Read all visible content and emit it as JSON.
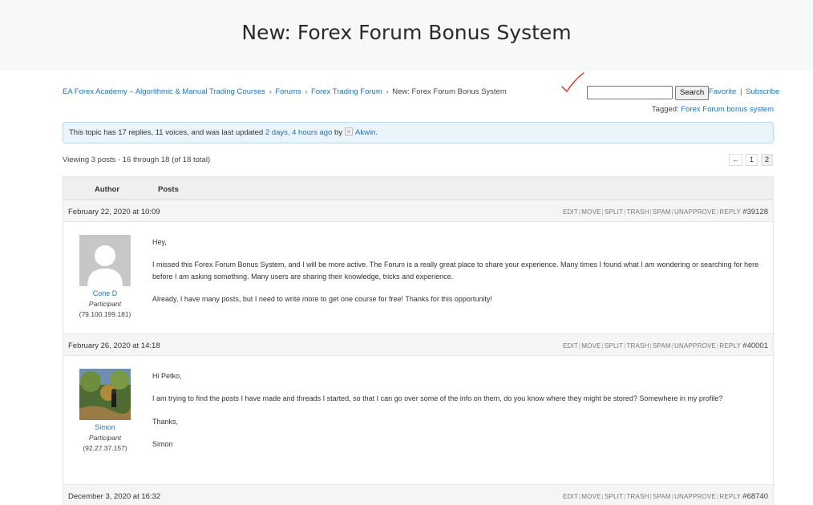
{
  "page": {
    "title": "New: Forex Forum Bonus System"
  },
  "breadcrumb": {
    "items": [
      "EA Forex Academy – Algorithmic & Manual Trading Courses",
      "Forums",
      "Forex Trading Forum",
      "New: Forex Forum Bonus System"
    ],
    "separator": "›"
  },
  "search": {
    "value": "",
    "placeholder": "",
    "button_label": "Search"
  },
  "topic_actions": {
    "favorite": "Favorite",
    "separator": "|",
    "subscribe": "Subscribe"
  },
  "tags": {
    "label": "Tagged:",
    "tag": "Forex Forum bonus system"
  },
  "notice": {
    "prefix": "This topic has 17 replies, 11 voices, and was last updated",
    "time_link": "2 days, 4 hours ago",
    "by": "by",
    "user": "Akwin",
    "suffix": "."
  },
  "viewing": "Viewing 3 posts - 16 through 18 (of 18 total)",
  "pagination": {
    "prev": "←",
    "pages": [
      "1",
      "2"
    ],
    "current": "2"
  },
  "table_header": {
    "author": "Author",
    "posts": "Posts"
  },
  "admin_links": [
    "EDIT",
    "MOVE",
    "SPLIT",
    "TRASH",
    "SPAM",
    "UNAPPROVE",
    "REPLY"
  ],
  "posts": [
    {
      "date": "February 22, 2020 at 10:09",
      "id": "#39128",
      "author": "Cone D",
      "role": "Participant",
      "ip": "(79.100.199.181)",
      "avatar": "default-avatar",
      "paragraphs": [
        "Hey,",
        "I missed this Forex Forum Bonus System, and I will be more active. The Forum is a really great place to share your experience. Many times I found what I am wondering or searching for here before I am asking something. Many users are sharing their knowledge, tricks and experience.",
        "Already, I have many posts, but I need to write more to get one course for free! Thanks for this opportunity!"
      ]
    },
    {
      "date": "February 26, 2020 at 14:18",
      "id": "#40001",
      "author": "Simon",
      "role": "Participant",
      "ip": "(92.27.37.157)",
      "avatar": "photo-avatar",
      "paragraphs": [
        "Hi Petko,",
        "I am trying to find the posts I have made and threads I started, so that I can go over some of the info on them, do you know where they might be stored? Somewhere in my profile?",
        "Thanks,",
        "Simon"
      ]
    },
    {
      "date": "December 3, 2020 at 16:32",
      "id": "#68740"
    }
  ],
  "colors": {
    "link": "#1f73b7",
    "title_bg": "#f7f8f9",
    "notice_bg": "#eaf4fb",
    "notice_border": "#b9d8ef",
    "checkmark": "#e0281f"
  }
}
